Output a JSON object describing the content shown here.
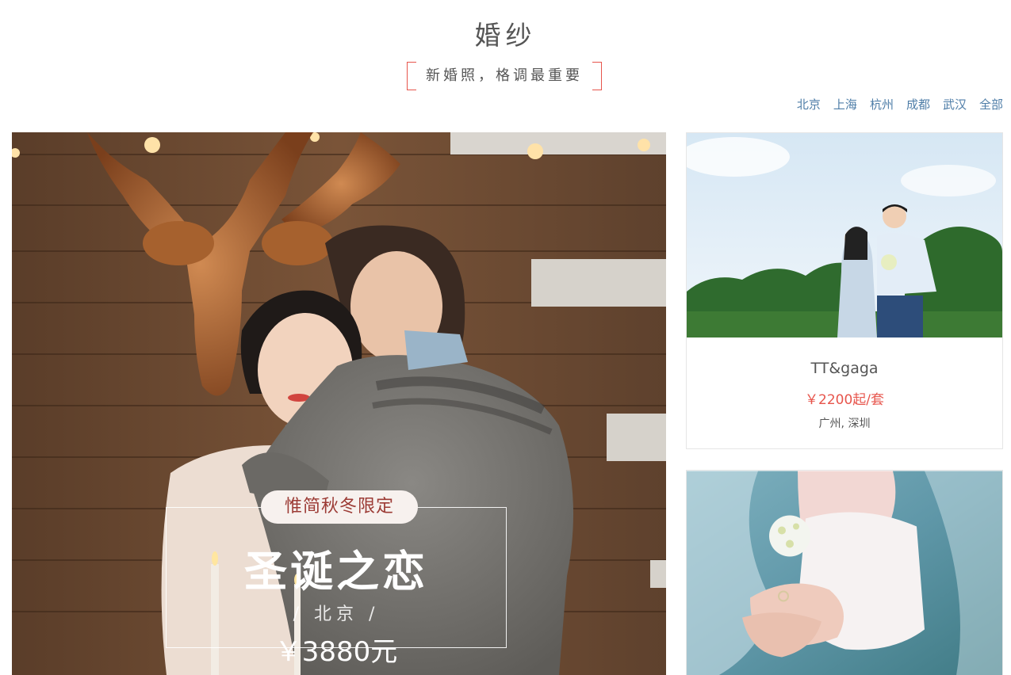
{
  "section": {
    "title": "婚纱",
    "subtitle": "新婚照，格调最重要"
  },
  "cities": [
    "北京",
    "上海",
    "杭州",
    "成都",
    "武汉",
    "全部"
  ],
  "hero": {
    "tag": "惟简秋冬限定",
    "name": "圣诞之恋",
    "city": "/ 北京 /",
    "price": "￥3880元"
  },
  "cards": [
    {
      "name": "TT&gaga",
      "price": "￥2200起/套",
      "location": "广州, 深圳"
    }
  ],
  "colors": {
    "accent": "#e7554c",
    "link": "#4f7ea8",
    "text": "#555555"
  }
}
